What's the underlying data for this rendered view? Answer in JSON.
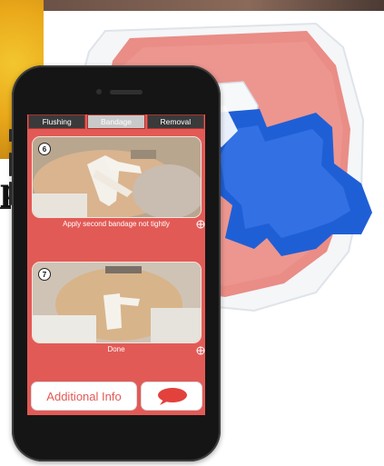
{
  "app": {
    "tabs": [
      {
        "label": "Flushing",
        "active": false
      },
      {
        "label": "Bandage",
        "active": true
      },
      {
        "label": "Removal",
        "active": false
      }
    ],
    "steps": [
      {
        "number": "6",
        "caption": "Apply second bandage not tightly"
      },
      {
        "number": "7",
        "caption": "Done"
      }
    ],
    "additional_info_label": "Additional Info",
    "chat_icon": "speech-bubble-icon",
    "caption_icon": "tap-icon"
  },
  "background": {
    "partial_letter": "p"
  },
  "colors": {
    "screen": "#e25a56",
    "tab_inactive": "#3a3a3a",
    "tab_active": "#c9c9c9",
    "dressing_pink": "#e98d86",
    "dressing_blue": "#1f5fd6"
  }
}
